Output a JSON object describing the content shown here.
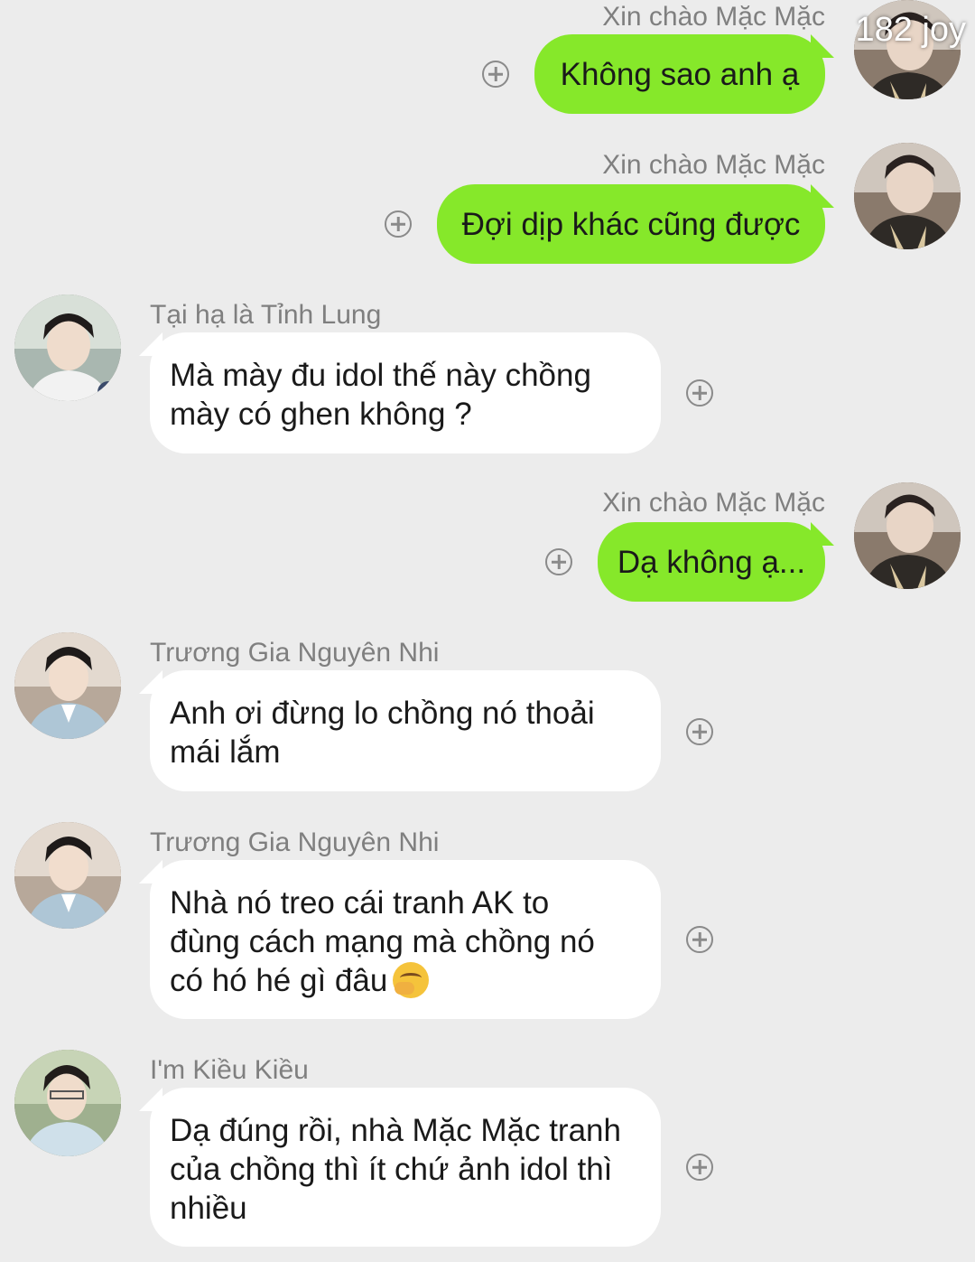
{
  "watermark": "182 joy",
  "messages": [
    {
      "direction": "out",
      "sender": "Xin chào Mặc Mặc",
      "text": "Không sao anh ạ",
      "avatar_icon": "user-avatar-icon"
    },
    {
      "direction": "out",
      "sender": "Xin chào Mặc Mặc",
      "text": "Đợi dịp khác cũng được",
      "avatar_icon": "user-avatar-icon"
    },
    {
      "direction": "in",
      "sender": "Tại hạ là Tỉnh Lung",
      "text": "Mà mày đu idol thế này chồng\nmày có ghen không ?",
      "avatar_icon": "user-avatar-icon"
    },
    {
      "direction": "out",
      "sender": "Xin chào Mặc Mặc",
      "text": "Dạ không ạ...",
      "avatar_icon": "user-avatar-icon"
    },
    {
      "direction": "in",
      "sender": "Trương Gia Nguyên Nhi",
      "text": "Anh ơi đừng lo chồng nó thoải\nmái lắm",
      "avatar_icon": "user-avatar-icon"
    },
    {
      "direction": "in",
      "sender": "Trương Gia Nguyên Nhi",
      "text": "Nhà nó treo cái tranh AK to\nđùng cách mạng mà chồng nó\ncó hó hé gì đâu",
      "emoji": "face-with-hand-over-mouth-emoji",
      "avatar_icon": "user-avatar-icon"
    },
    {
      "direction": "in",
      "sender": "I'm Kiều Kiều",
      "text": "Dạ đúng rồi, nhà Mặc Mặc tranh\ncủa chồng thì ít chứ ảnh idol thì\nnhiều",
      "avatar_icon": "user-avatar-icon"
    }
  ],
  "action_icon": "add-reaction-icon",
  "colors": {
    "background": "#ececec",
    "outgoing_bubble": "#86e82a",
    "incoming_bubble": "#ffffff",
    "sender_text": "#7f7f7f",
    "message_text": "#1a1a1a"
  }
}
